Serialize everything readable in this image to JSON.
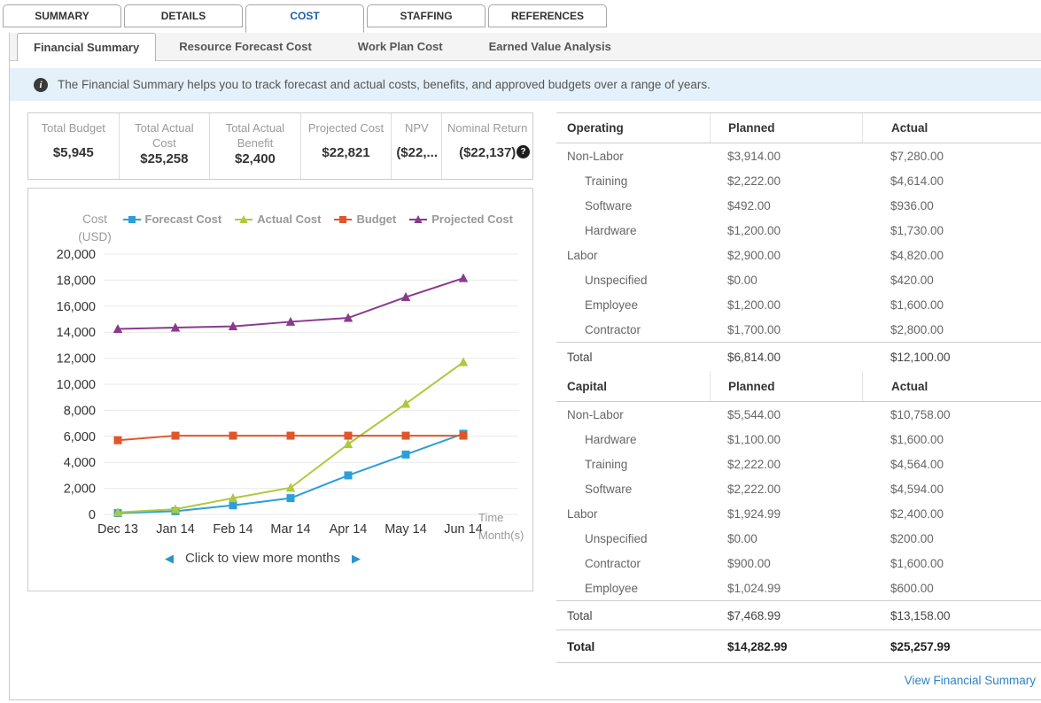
{
  "main_tabs": {
    "items": [
      {
        "label": "SUMMARY",
        "active": false
      },
      {
        "label": "DETAILS",
        "active": false
      },
      {
        "label": "COST",
        "active": true
      },
      {
        "label": "STAFFING",
        "active": false
      },
      {
        "label": "REFERENCES",
        "active": false
      }
    ]
  },
  "sub_tabs": {
    "items": [
      {
        "label": "Financial Summary",
        "active": true
      },
      {
        "label": "Resource Forecast Cost",
        "active": false
      },
      {
        "label": "Work Plan Cost",
        "active": false
      },
      {
        "label": "Earned Value Analysis",
        "active": false
      }
    ]
  },
  "banner": {
    "icon": "i",
    "text": "The Financial Summary helps you to track forecast and actual costs, benefits, and approved budgets over a range of years."
  },
  "kpis": {
    "help_icon": "?",
    "items": [
      {
        "label": "Total Budget",
        "value": "$5,945"
      },
      {
        "label": "Total Actual Cost",
        "value": "$25,258"
      },
      {
        "label": "Total Actual Benefit",
        "value": "$2,400"
      },
      {
        "label": "Projected Cost",
        "value": "$22,821"
      },
      {
        "label": "NPV",
        "value": "($22,..."
      },
      {
        "label": "Nominal Return",
        "value": "($22,137)",
        "has_help": true
      }
    ]
  },
  "chart_data": {
    "type": "line",
    "ylabel": "Cost (USD)",
    "ylabel_lines": [
      "Cost",
      "(USD)"
    ],
    "xlabel": "Time Month(s)",
    "xlabel_lines": [
      "Time",
      "Month(s)"
    ],
    "categories": [
      "Dec 13",
      "Jan 14",
      "Feb 14",
      "Mar 14",
      "Apr 14",
      "May 14",
      "Jun 14"
    ],
    "ylim": [
      0,
      20000
    ],
    "ytick_step": 2000,
    "grid": true,
    "legend_position": "top",
    "series": [
      {
        "name": "Forecast Cost",
        "color": "#2d9fd8",
        "marker": "square",
        "values": [
          100,
          250,
          700,
          1250,
          3000,
          4600,
          6200
        ]
      },
      {
        "name": "Actual Cost",
        "color": "#aec93c",
        "marker": "triangle",
        "values": [
          150,
          400,
          1250,
          2050,
          5400,
          8500,
          11700
        ]
      },
      {
        "name": "Budget",
        "color": "#e0562b",
        "marker": "square",
        "values": [
          5700,
          6050,
          6050,
          6050,
          6050,
          6050,
          6050
        ]
      },
      {
        "name": "Projected Cost",
        "color": "#8a3a8e",
        "marker": "triangle",
        "values": [
          14250,
          14350,
          14450,
          14800,
          15100,
          16700,
          18150
        ]
      }
    ],
    "pager": {
      "prev_icon": "◀",
      "label": "Click to view more months",
      "next_icon": "▶"
    }
  },
  "cost_table": {
    "sections": [
      {
        "header": {
          "category": "Operating",
          "planned": "Planned",
          "actual": "Actual"
        },
        "rows": [
          {
            "label": "Non-Labor",
            "indent": 0,
            "planned": "$3,914.00",
            "actual": "$7,280.00"
          },
          {
            "label": "Training",
            "indent": 1,
            "planned": "$2,222.00",
            "actual": "$4,614.00"
          },
          {
            "label": "Software",
            "indent": 1,
            "planned": "$492.00",
            "actual": "$936.00"
          },
          {
            "label": "Hardware",
            "indent": 1,
            "planned": "$1,200.00",
            "actual": "$1,730.00"
          },
          {
            "label": "Labor",
            "indent": 0,
            "planned": "$2,900.00",
            "actual": "$4,820.00"
          },
          {
            "label": "Unspecified",
            "indent": 1,
            "planned": "$0.00",
            "actual": "$420.00"
          },
          {
            "label": "Employee",
            "indent": 1,
            "planned": "$1,200.00",
            "actual": "$1,600.00"
          },
          {
            "label": "Contractor",
            "indent": 1,
            "planned": "$1,700.00",
            "actual": "$2,800.00"
          }
        ],
        "total": {
          "label": "Total",
          "planned": "$6,814.00",
          "actual": "$12,100.00"
        }
      },
      {
        "header": {
          "category": "Capital",
          "planned": "Planned",
          "actual": "Actual"
        },
        "rows": [
          {
            "label": "Non-Labor",
            "indent": 0,
            "planned": "$5,544.00",
            "actual": "$10,758.00"
          },
          {
            "label": "Hardware",
            "indent": 1,
            "planned": "$1,100.00",
            "actual": "$1,600.00"
          },
          {
            "label": "Training",
            "indent": 1,
            "planned": "$2,222.00",
            "actual": "$4,564.00"
          },
          {
            "label": "Software",
            "indent": 1,
            "planned": "$2,222.00",
            "actual": "$4,594.00"
          },
          {
            "label": "Labor",
            "indent": 0,
            "planned": "$1,924.99",
            "actual": "$2,400.00"
          },
          {
            "label": "Unspecified",
            "indent": 1,
            "planned": "$0.00",
            "actual": "$200.00"
          },
          {
            "label": "Contractor",
            "indent": 1,
            "planned": "$900.00",
            "actual": "$1,600.00"
          },
          {
            "label": "Employee",
            "indent": 1,
            "planned": "$1,024.99",
            "actual": "$600.00"
          }
        ],
        "total": {
          "label": "Total",
          "planned": "$7,468.99",
          "actual": "$13,158.00"
        }
      }
    ],
    "grand_total": {
      "label": "Total",
      "planned": "$14,282.99",
      "actual": "$25,257.99"
    },
    "footer_link": "View Financial Summary"
  }
}
